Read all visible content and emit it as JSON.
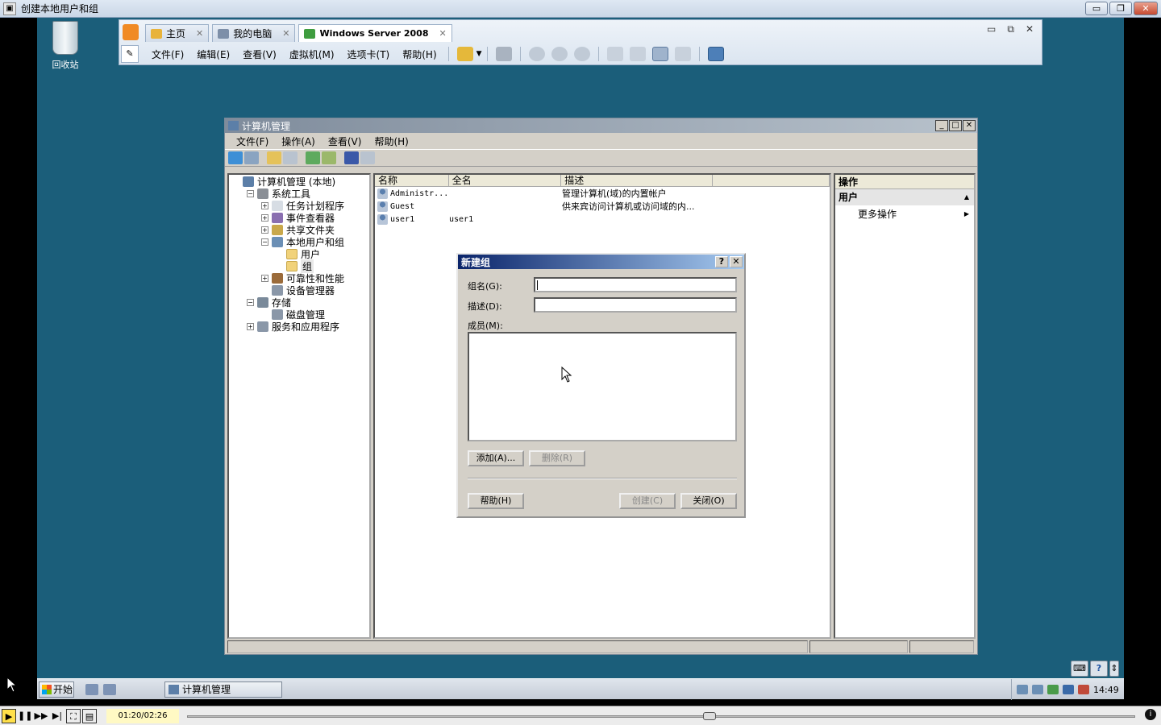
{
  "outer": {
    "title": "创建本地用户和组",
    "min": "▭",
    "max": "❐",
    "close": "✕"
  },
  "desktop": {
    "recycle_label": "回收站"
  },
  "vmware": {
    "tabs": [
      {
        "label": "主页"
      },
      {
        "label": "我的电脑"
      },
      {
        "label": "Windows Server 2008"
      }
    ],
    "tab_close": "✕",
    "menus": [
      "文件(F)",
      "编辑(E)",
      "查看(V)",
      "虚拟机(M)",
      "选项卡(T)",
      "帮助(H)"
    ],
    "ctrls": {
      "min": "▭",
      "restore": "⧉",
      "close": "✕"
    }
  },
  "mmc": {
    "title": "计算机管理",
    "menus": [
      "文件(F)",
      "操作(A)",
      "查看(V)",
      "帮助(H)"
    ],
    "tree": [
      {
        "label": "计算机管理 (本地)",
        "level": 0,
        "expander": "",
        "icon": "computer-icon"
      },
      {
        "label": "系统工具",
        "level": 1,
        "expander": "−",
        "icon": "tools-icon"
      },
      {
        "label": "任务计划程序",
        "level": 2,
        "expander": "+",
        "icon": "clock-icon"
      },
      {
        "label": "事件查看器",
        "level": 2,
        "expander": "+",
        "icon": "event-icon"
      },
      {
        "label": "共享文件夹",
        "level": 2,
        "expander": "+",
        "icon": "share-icon"
      },
      {
        "label": "本地用户和组",
        "level": 2,
        "expander": "−",
        "icon": "users-icon"
      },
      {
        "label": "用户",
        "level": 3,
        "expander": "",
        "icon": "folder-icon"
      },
      {
        "label": "组",
        "level": 3,
        "expander": "",
        "icon": "folder-icon"
      },
      {
        "label": "可靠性和性能",
        "level": 2,
        "expander": "+",
        "icon": "perf-icon"
      },
      {
        "label": "设备管理器",
        "level": 2,
        "expander": "",
        "icon": "device-icon"
      },
      {
        "label": "存储",
        "level": 1,
        "expander": "−",
        "icon": "storage-icon"
      },
      {
        "label": "磁盘管理",
        "level": 2,
        "expander": "",
        "icon": "disk-icon"
      },
      {
        "label": "服务和应用程序",
        "level": 1,
        "expander": "+",
        "icon": "services-icon"
      }
    ],
    "columns": [
      "名称",
      "全名",
      "描述"
    ],
    "rows": [
      {
        "name": "Administr...",
        "full": "",
        "desc": "管理计算机(域)的内置帐户"
      },
      {
        "name": "Guest",
        "full": "",
        "desc": "供来宾访问计算机或访问域的内..."
      },
      {
        "name": "user1",
        "full": "user1",
        "desc": ""
      }
    ],
    "actions": {
      "header": "操作",
      "section": "用户",
      "item": "更多操作"
    }
  },
  "dialog": {
    "title": "新建组",
    "help_q": "?",
    "close_x": "✕",
    "group_name_label": "组名(G):",
    "group_name_value": "",
    "desc_label": "描述(D):",
    "desc_value": "",
    "members_label": "成员(M):",
    "add_button": "添加(A)...",
    "remove_button": "删除(R)",
    "help_button": "帮助(H)",
    "create_button": "创建(C)",
    "close_button": "关闭(O)"
  },
  "taskbar": {
    "start": "开始",
    "task": "计算机管理",
    "clock": "14:49",
    "help_glyph": "?"
  },
  "player": {
    "time": "01:20/02:26",
    "progress": 0.55,
    "info": "i"
  }
}
